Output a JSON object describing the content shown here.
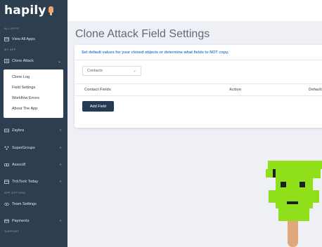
{
  "brand": {
    "logo_text": "hapily"
  },
  "sidebar": {
    "sections": {
      "all_apps": "ALL APPS",
      "my_app": "MY APP",
      "app_options": "APP OPTIONS",
      "support": "SUPPORT"
    },
    "items": {
      "view_all_apps": "View All Apps",
      "clone_attack": "Clone Attack",
      "zaybra": "Zaybra",
      "supergroups": "SuperGroups",
      "associ8": "Associ8",
      "ticktock_today": "TickTock Today",
      "team_settings": "Team Settings",
      "payments": "Payments"
    },
    "submenu": [
      "Clone Log",
      "Field Settings",
      "Workflow Errors",
      "About The App"
    ]
  },
  "main": {
    "title": "Clone Attack Field Settings",
    "description": "Set default values for your cloned objects or determine what fields to NOT copy.",
    "object_select": {
      "value": "Contacts"
    },
    "table": {
      "columns": [
        "Contact Fields",
        "Action",
        "Default"
      ]
    },
    "add_field_label": "Add Field"
  },
  "colors": {
    "sidebar_bg": "#2c3e50",
    "accent_blue": "#3c7bd6",
    "button_dark": "#253b54",
    "mascot_green": "#8fe01a",
    "logo_orange": "#f5a266"
  }
}
